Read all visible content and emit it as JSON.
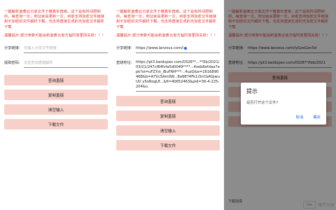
{
  "intro": "一键解析蓝奏云分享文件下载真实直链，这个是有时间限制的，每查询一次，地址就会更新一次，目前支持加密文件链接和不加密的文件解析下载，也支持直接生成的无加密文件解析下载",
  "warning": "温馨提示:部分参数可能会新蓝奏云官方临时变更而失效！！！",
  "share_label": "分享链接:",
  "password_label": "提取密码:",
  "share_placeholder": "在输入分享文件链接",
  "password_placeholder": "点击查询直链解析",
  "buttons": {
    "query": "查询直链",
    "copy": "复制直链",
    "clear": "清空输入",
    "download": "下载文件"
  },
  "screen2": {
    "share_value": "https://www.lanzous.com/i",
    "link_label": "直链地址:",
    "link_value": "https://pt3.baidupan.com/0326**...**0b/2021/03/21/247cf84fcfa5d0049****...4xeb6efdaa7apk?st=uFZYst_iBuFNH***...4uzQ&e=1616890468&b=A7Vc5Am0W...8a9874Fk1i3nCbAGjwuUU y5oNogUf...&fi=40652463&pid=36-4-225-204&u"
  },
  "screen3": {
    "share_value": "https://www.lanzous.com/iyGzxGxn5d",
    "link_value": "https://pt3.baidupan.com/0326**/feb/2021",
    "dialog_title": "提示",
    "dialog_message": "是否打开这个文件?",
    "dialog_cancel": "取消",
    "dialog_confirm": "确定",
    "bottom_note": "下载完成"
  },
  "watermark": {
    "logo": "Nw",
    "text": "嗨学分享"
  }
}
